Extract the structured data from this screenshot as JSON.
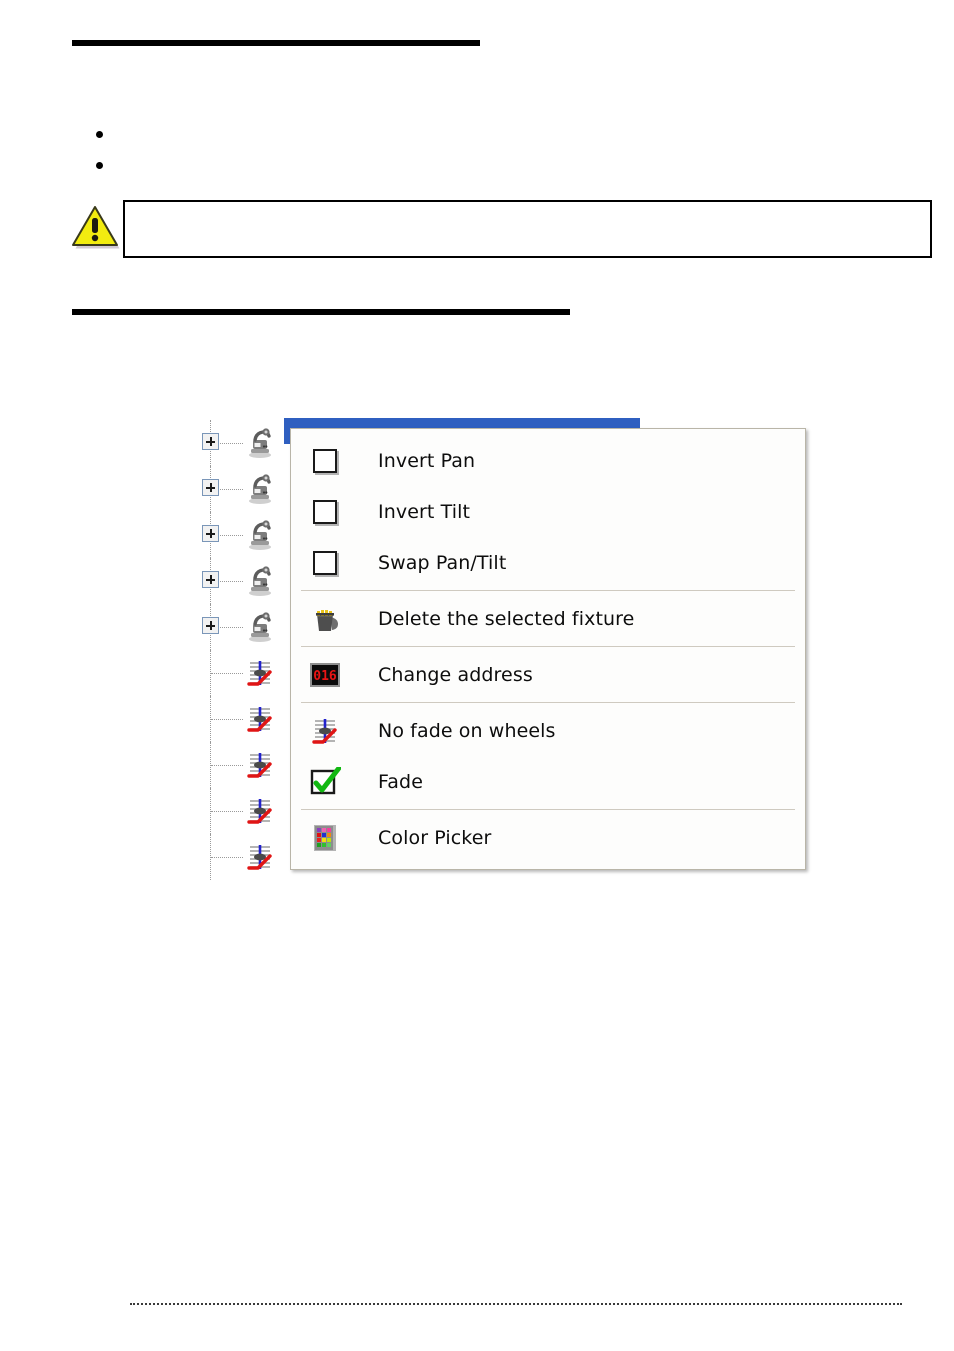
{
  "document": {
    "heading_rule_top": "",
    "heading_rule_second": "",
    "bullets": [
      "",
      ""
    ],
    "warning": {
      "icon": "warning-triangle-icon",
      "text": ""
    },
    "footer": {
      "text": ""
    }
  },
  "figure": {
    "tree": {
      "fixture_nodes": [
        {
          "expander": "+",
          "icon": "moving-head-fixture-icon",
          "label": ""
        },
        {
          "expander": "+",
          "icon": "moving-head-fixture-icon",
          "label": ""
        },
        {
          "expander": "+",
          "icon": "moving-head-fixture-icon",
          "label": ""
        },
        {
          "expander": "+",
          "icon": "moving-head-fixture-icon",
          "label": ""
        },
        {
          "expander": "+",
          "icon": "moving-head-fixture-icon",
          "label": ""
        }
      ],
      "channel_nodes": [
        {
          "icon": "no-fade-fader-icon",
          "label": ""
        },
        {
          "icon": "no-fade-fader-icon",
          "label": ""
        },
        {
          "icon": "no-fade-fader-icon",
          "label": ""
        },
        {
          "icon": "no-fade-fader-icon",
          "label": ""
        },
        {
          "icon": "no-fade-fader-icon",
          "label": ""
        }
      ],
      "selection_color": "#2f5fc0"
    },
    "context_menu": {
      "items": [
        {
          "id": "invert-pan",
          "label": "Invert Pan",
          "icon": "checkbox-unchecked-icon",
          "checked": false
        },
        {
          "id": "invert-tilt",
          "label": "Invert Tilt",
          "icon": "checkbox-unchecked-icon",
          "checked": false
        },
        {
          "id": "swap-pan-tilt",
          "label": "Swap Pan/Tilt",
          "icon": "checkbox-unchecked-icon",
          "checked": false
        },
        {
          "id": "delete-fixture",
          "label": "Delete the selected fixture",
          "icon": "trash-can-icon"
        },
        {
          "id": "change-address",
          "label": "Change address",
          "icon": "dmx-address-display-icon",
          "icon_text": "016"
        },
        {
          "id": "no-fade-wheels",
          "label": "No fade on wheels",
          "icon": "no-fade-fader-icon"
        },
        {
          "id": "fade",
          "label": "Fade",
          "icon": "checkbox-checked-green-icon",
          "checked": true
        },
        {
          "id": "color-picker",
          "label": "Color Picker",
          "icon": "color-picker-palette-icon"
        }
      ],
      "separators_after": [
        "swap-pan-tilt",
        "delete-fixture",
        "change-address",
        "fade"
      ],
      "colors": {
        "background": "#fdfdfc",
        "border": "#b9b5a8",
        "separator": "#cfcac0",
        "text": "#0d0d0d",
        "led_red": "#e81414",
        "check_green": "#11b811"
      }
    }
  }
}
